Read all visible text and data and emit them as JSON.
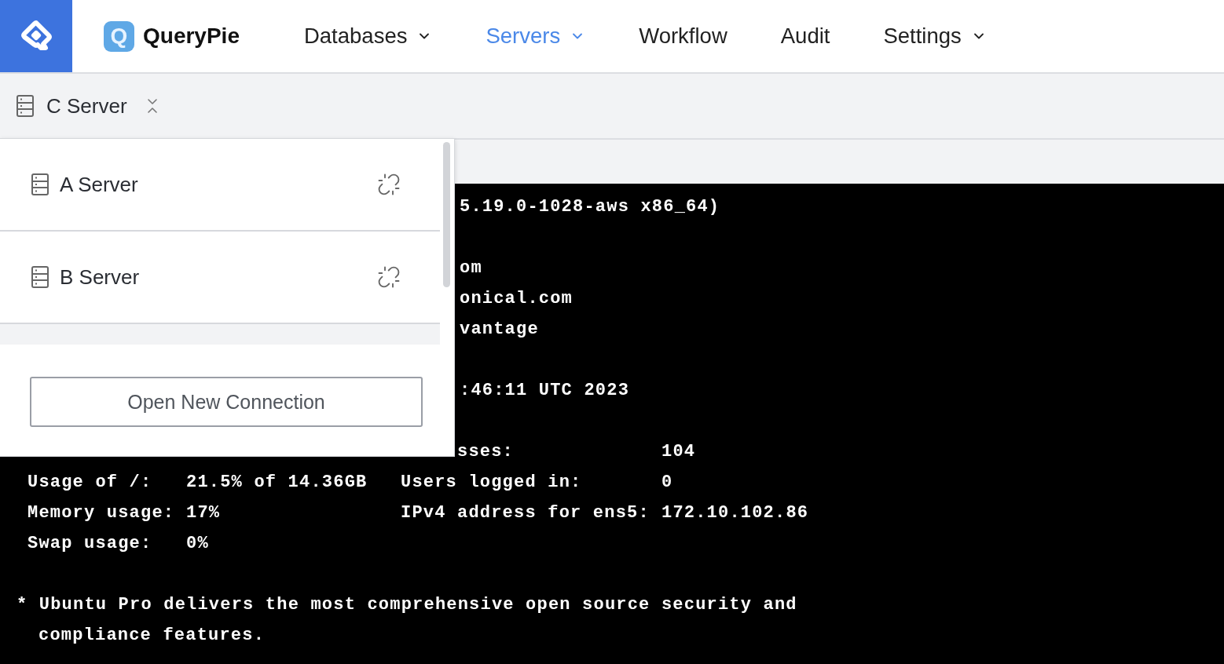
{
  "header": {
    "brand": {
      "mark": "Q",
      "name": "QueryPie"
    },
    "nav": [
      {
        "label": "Databases",
        "selected": false,
        "has_menu": true
      },
      {
        "label": "Servers",
        "selected": true,
        "has_menu": true
      },
      {
        "label": "Workflow",
        "selected": false,
        "has_menu": false
      },
      {
        "label": "Audit",
        "selected": false,
        "has_menu": false
      },
      {
        "label": "Settings",
        "selected": false,
        "has_menu": true
      }
    ]
  },
  "server_bar": {
    "current": "C Server",
    "expanded": true
  },
  "server_menu": {
    "items": [
      {
        "name": "A Server",
        "connected": false
      },
      {
        "name": "B Server",
        "connected": false
      }
    ],
    "button": "Open New Connection"
  },
  "terminal": {
    "lines": [
      {
        "kind": "covered",
        "text": "5.19.0-1028-aws x86_64)"
      },
      {
        "kind": "blank"
      },
      {
        "kind": "covered",
        "text": "om"
      },
      {
        "kind": "covered",
        "text": "onical.com"
      },
      {
        "kind": "covered",
        "text": "vantage"
      },
      {
        "kind": "blank"
      },
      {
        "kind": "covered",
        "text": ":46:11 UTC 2023"
      },
      {
        "kind": "blank"
      },
      {
        "kind": "covered-row",
        "cells": [
          "sses:",
          "104"
        ]
      },
      {
        "kind": "row",
        "cells": [
          "Usage of /:",
          "21.5% of 14.36GB",
          "Users logged in:",
          "0"
        ]
      },
      {
        "kind": "row",
        "cells": [
          "Memory usage:",
          "17%",
          "IPv4 address for ens5:",
          "172.10.102.86"
        ]
      },
      {
        "kind": "row",
        "cells": [
          "Swap usage:",
          "0%"
        ]
      },
      {
        "kind": "blank"
      },
      {
        "kind": "text",
        "text": "* Ubuntu Pro delivers the most comprehensive open source security and"
      },
      {
        "kind": "continued",
        "text": "compliance features."
      }
    ]
  }
}
